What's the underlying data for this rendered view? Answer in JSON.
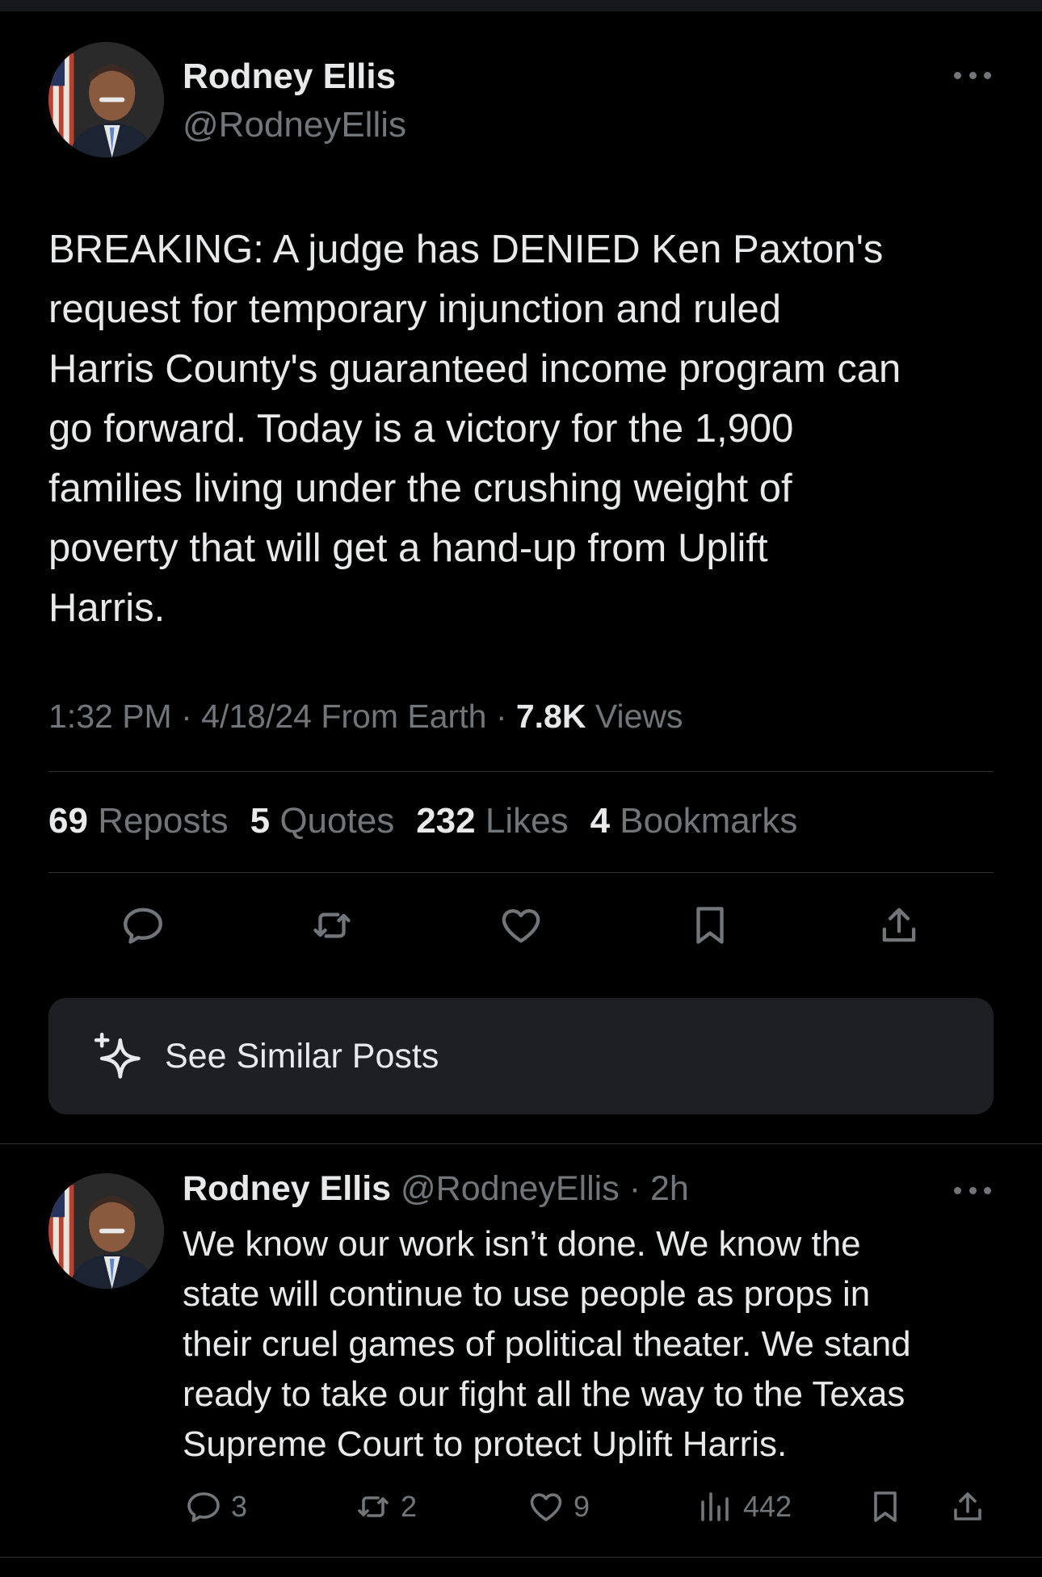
{
  "main_post": {
    "author_name": "Rodney Ellis",
    "author_handle": "@RodneyEllis",
    "text": "BREAKING: A judge has DENIED Ken Paxton's\nrequest for temporary injunction and ruled\nHarris County's guaranteed income program can\ngo forward. Today is a victory for the 1,900\nfamilies living under the crushing weight of\npoverty that will get a hand-up from Uplift\nHarris.",
    "time": "1:32 PM",
    "date": "4/18/24",
    "source": "From Earth",
    "views_count": "7.8K",
    "views_label": "Views",
    "stats": {
      "reposts_count": "69",
      "reposts_label": "Reposts",
      "quotes_count": "5",
      "quotes_label": "Quotes",
      "likes_count": "232",
      "likes_label": "Likes",
      "bookmarks_count": "4",
      "bookmarks_label": "Bookmarks"
    },
    "actions": [
      "reply-icon",
      "repost-icon",
      "like-icon",
      "bookmark-icon",
      "share-icon"
    ]
  },
  "see_similar": {
    "label": "See Similar Posts",
    "icon": "sparkle-icon"
  },
  "reply_post": {
    "author_name": "Rodney Ellis",
    "author_handle": "@RodneyEllis",
    "separator": "·",
    "age": "2h",
    "text": "We know our work isn’t done. We know the\nstate will continue to use people as props in\ntheir cruel games of political theater. We stand\nready to take our fight all the way to the Texas\nSupreme Court to protect Uplift Harris.",
    "replies": "3",
    "reposts": "2",
    "likes": "9",
    "views": "442"
  },
  "colors": {
    "background": "#000000",
    "text_primary": "#e7e9ea",
    "text_secondary": "#71767b",
    "divider": "#2f3336",
    "card": "#1d1f23"
  }
}
